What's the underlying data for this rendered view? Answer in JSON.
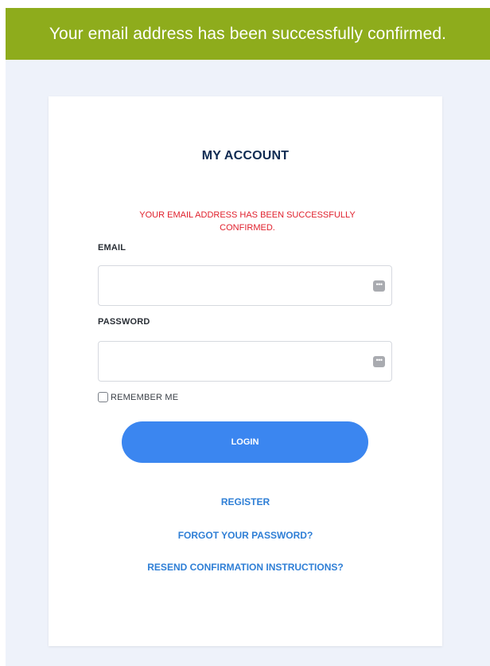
{
  "flash": {
    "message": "Your email address has been successfully confirmed."
  },
  "card": {
    "title": "MY ACCOUNT",
    "alert": "YOUR EMAIL ADDRESS HAS BEEN SUCCESSFULLY CONFIRMED.",
    "email": {
      "label": "EMAIL",
      "value": ""
    },
    "password": {
      "label": "PASSWORD",
      "value": ""
    },
    "remember_me": {
      "label": "REMEMBER ME",
      "checked": false
    },
    "login_label": "LOGIN",
    "links": {
      "register": "REGISTER",
      "forgot_password": "FORGOT YOUR PASSWORD?",
      "resend_confirmation": "RESEND CONFIRMATION INSTRUCTIONS?"
    },
    "field_icon": "password-manager-key-icon"
  },
  "colors": {
    "flash_bg": "#8eac1c",
    "page_bg": "#eef2fa",
    "title": "#0f2b52",
    "alert": "#e0202c",
    "button": "#3b86f0",
    "link": "#2f7fd6"
  }
}
